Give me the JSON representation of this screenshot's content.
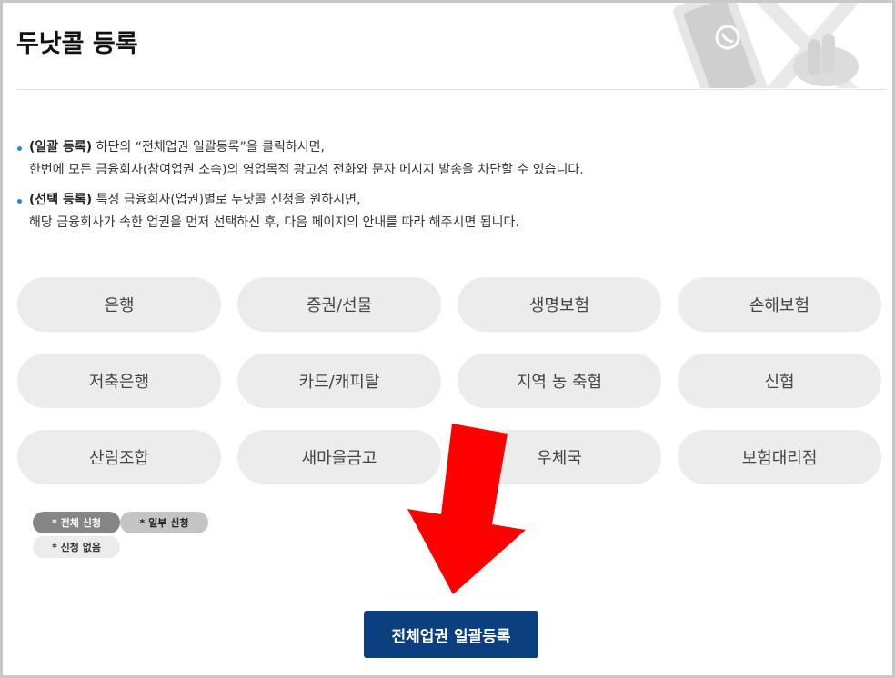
{
  "page": {
    "title": "두낫콜 등록"
  },
  "info": [
    {
      "strong": "(일괄 등록)",
      "line1": " 하단의 “전체업권 일괄등록”을 클릭하시면,",
      "line2": "한번에 모든 금융회사(참여업권 소속)의 영업목적 광고성 전화와 문자 메시지 발송을 차단할 수 있습니다."
    },
    {
      "strong": "(선택 등록)",
      "line1": " 특정 금융회사(업권)별로 두낫콜 신청을 원하시면,",
      "line2": "해당 금융회사가 속한 업권을 먼저 선택하신 후, 다음 페이지의 안내를 따라 해주시면 됩니다."
    }
  ],
  "categories": [
    "은행",
    "증권/선물",
    "생명보험",
    "손해보험",
    "저축은행",
    "카드/캐피탈",
    "지역 농 축협",
    "신협",
    "산림조합",
    "새마을금고",
    "우체국",
    "보험대리점"
  ],
  "legend": {
    "all": "* 전체 신청",
    "partial": "* 일부 신청",
    "none": "* 신청 없음"
  },
  "submit_label": "전체업권 일괄등록",
  "colors": {
    "button_bg": "#ececec",
    "submit_bg": "#0b3f7e",
    "arrow": "#ff0000",
    "bullet": "#1a8ccf"
  }
}
